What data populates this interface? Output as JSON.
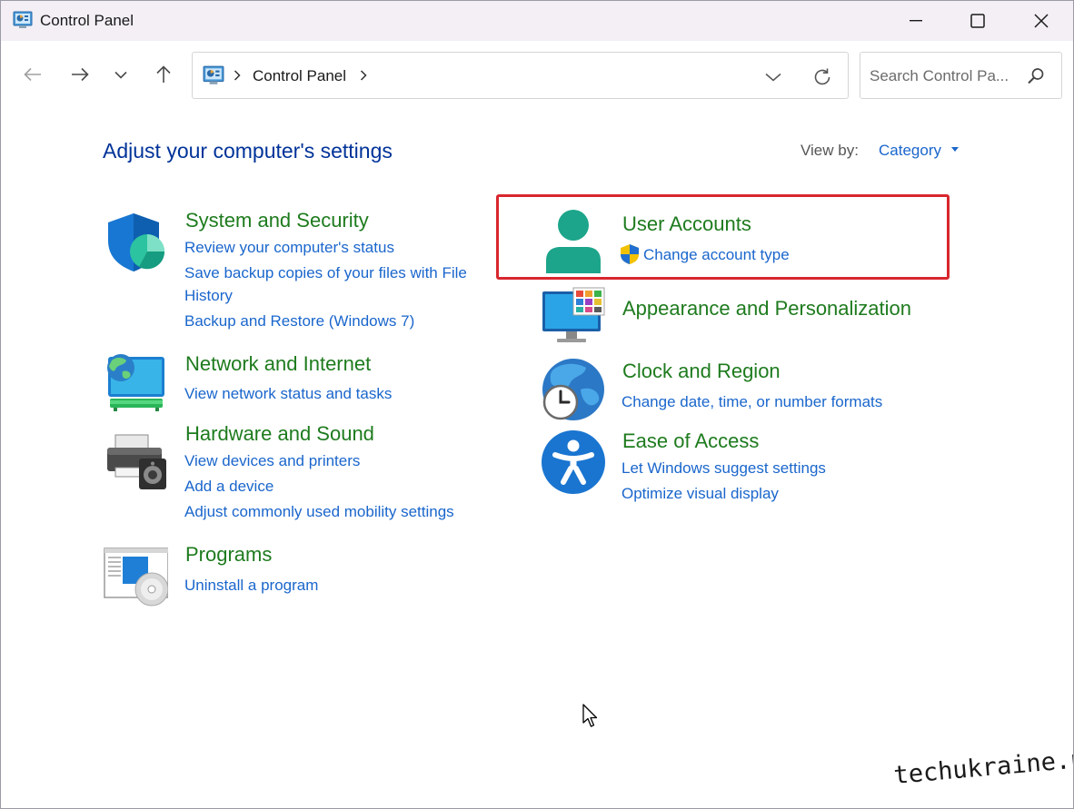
{
  "window": {
    "title": "Control Panel"
  },
  "navigation": {
    "breadcrumb": [
      "Control Panel"
    ],
    "search_placeholder": "Search Control Pa..."
  },
  "content": {
    "heading": "Adjust your computer's settings",
    "view_by_label": "View by:",
    "view_by_value": "Category",
    "categories": [
      {
        "title": "System and Security",
        "icon": "shield-icon",
        "links": [
          "Review your computer's status",
          "Save backup copies of your files with File",
          "History",
          "Backup and Restore (Windows 7)"
        ]
      },
      {
        "title": "Network and Internet",
        "icon": "network-globe-icon",
        "links": [
          "View network status and tasks"
        ]
      },
      {
        "title": "Hardware and Sound",
        "icon": "printer-speaker-icon",
        "links": [
          "View devices and printers",
          "Add a device",
          "Adjust commonly used mobility settings"
        ]
      },
      {
        "title": "Programs",
        "icon": "programs-disc-icon",
        "links": [
          "Uninstall a program"
        ]
      },
      {
        "title": "User Accounts",
        "icon": "user-icon",
        "links": [
          "Change account type"
        ],
        "highlighted": true
      },
      {
        "title": "Appearance and Personalization",
        "icon": "monitor-icon",
        "links": []
      },
      {
        "title": "Clock and Region",
        "icon": "clock-globe-icon",
        "links": [
          "Change date, time, or number formats"
        ]
      },
      {
        "title": "Ease of Access",
        "icon": "accessibility-icon",
        "links": [
          "Let Windows suggest settings",
          "Optimize visual display"
        ]
      }
    ]
  },
  "watermark": "techukraine.net",
  "colors": {
    "heading": "#003399",
    "category_title": "#1e7b1e",
    "link": "#1a66cc",
    "highlight_border": "#d9262e",
    "titlebar_bg": "#f3eff5"
  }
}
